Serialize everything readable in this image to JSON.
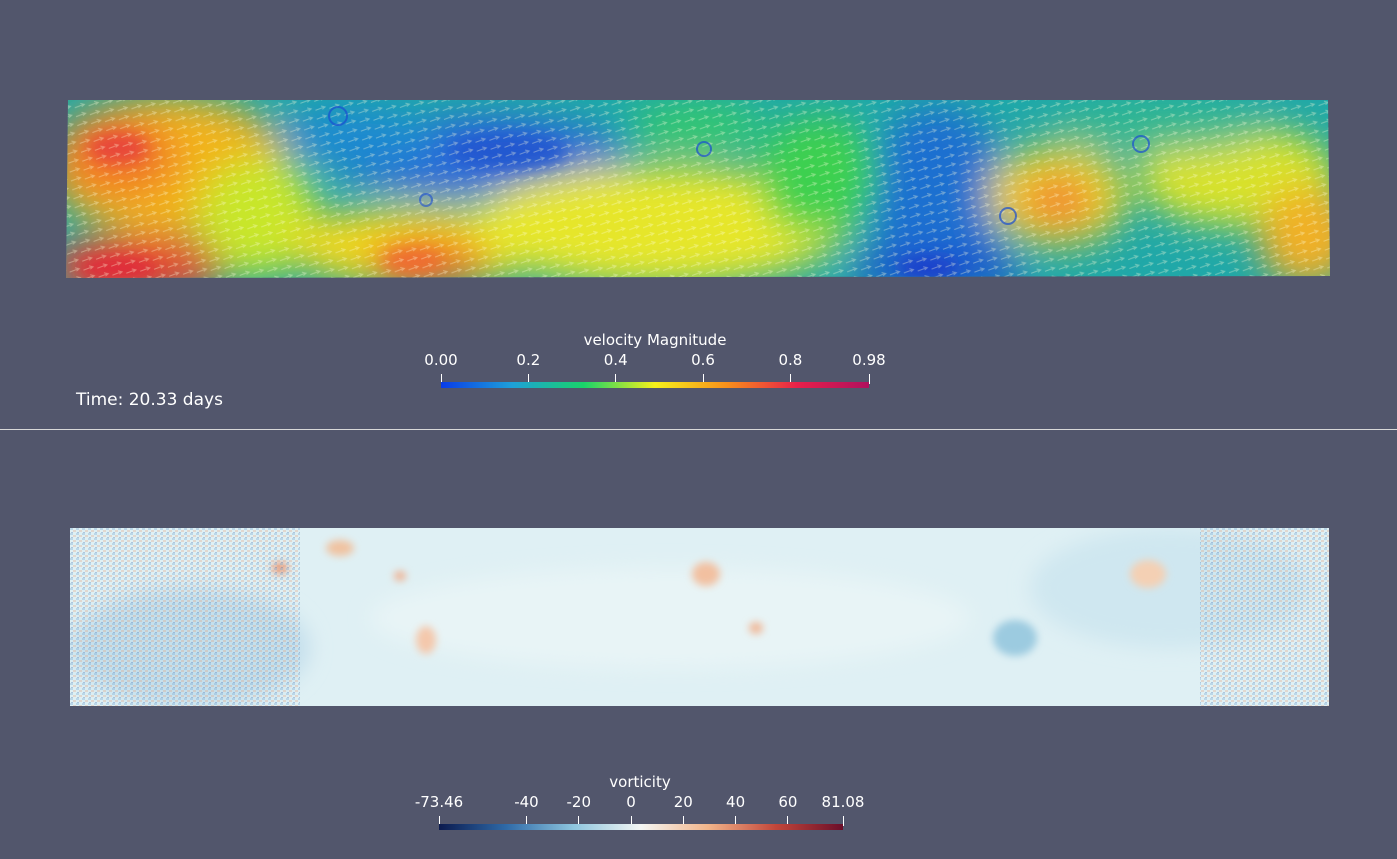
{
  "top_view": {
    "field_name": "velocity-magnitude-glyph-field",
    "colorbar": {
      "title": "velocity Magnitude",
      "ticks": [
        "0.00",
        "0.2",
        "0.4",
        "0.6",
        "0.8",
        "0.98"
      ],
      "tick_values": [
        0.0,
        0.2,
        0.4,
        0.6,
        0.8,
        0.98
      ],
      "range": [
        0.0,
        0.98
      ],
      "colormap": [
        "#0a3ce8",
        "#1ea0d8",
        "#19d36a",
        "#f6f01a",
        "#f8901a",
        "#e8204a",
        "#b0105e"
      ]
    },
    "time_label": "Time: 20.33 days"
  },
  "bottom_view": {
    "field_name": "vorticity-field",
    "colorbar": {
      "title": "vorticity",
      "ticks": [
        "-73.46",
        "-40",
        "-20",
        "0",
        "20",
        "40",
        "60",
        "81.08"
      ],
      "tick_values": [
        -73.46,
        -40,
        -20,
        0,
        20,
        40,
        60,
        81.08
      ],
      "range": [
        -73.46,
        81.08
      ],
      "colormap": [
        "#0b1a4e",
        "#2f6aa8",
        "#8ec5de",
        "#f4f6f4",
        "#f1b48a",
        "#c2463a",
        "#6b0e2a"
      ]
    }
  },
  "colors": {
    "background": "#52566c",
    "divider": "#d8d8d8",
    "text": "#ffffff"
  }
}
